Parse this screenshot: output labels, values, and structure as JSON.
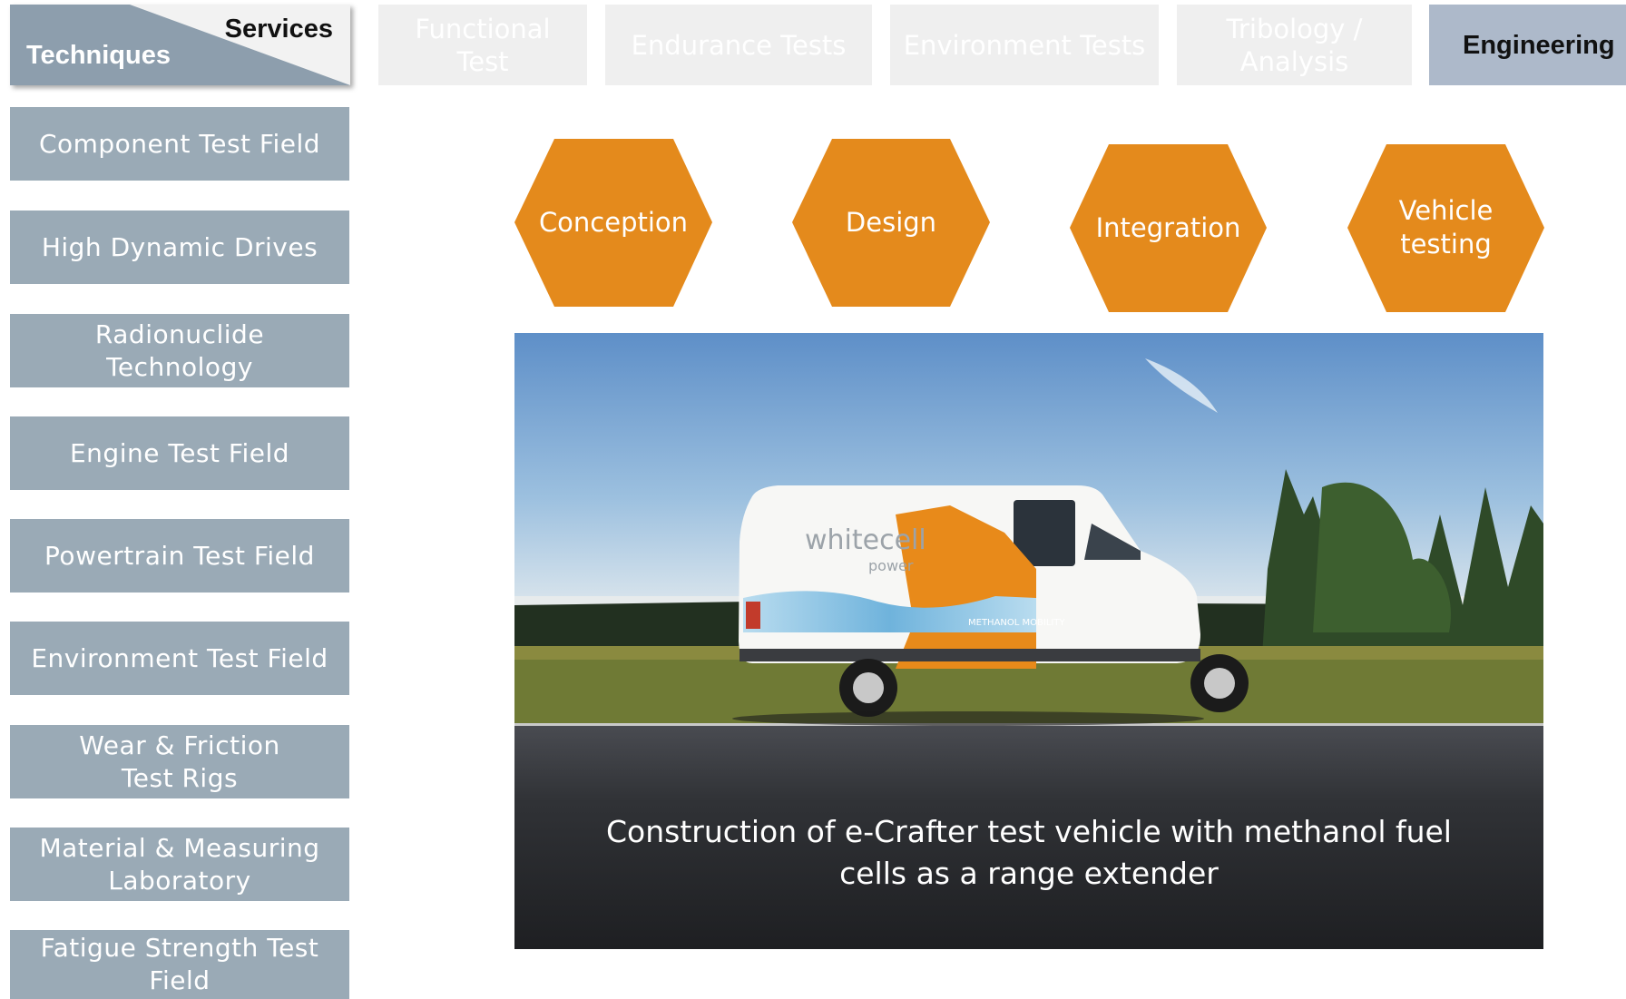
{
  "header": {
    "services_label": "Services",
    "techniques_label": "Techniques"
  },
  "service_tabs": [
    {
      "label": "Functional\nTest",
      "active": false
    },
    {
      "label": "Endurance Tests",
      "active": false
    },
    {
      "label": "Environment Tests",
      "active": false
    },
    {
      "label": "Tribology /\nAnalysis",
      "active": false
    },
    {
      "label": "Engineering",
      "active": true
    }
  ],
  "sidebar": {
    "items": [
      {
        "label": "Component Test Field"
      },
      {
        "label": "High Dynamic Drives"
      },
      {
        "label": "Radionuclide\nTechnology"
      },
      {
        "label": "Engine Test Field"
      },
      {
        "label": "Powertrain Test Field"
      },
      {
        "label": "Environment Test Field"
      },
      {
        "label": "Wear & Friction\nTest Rigs"
      },
      {
        "label": "Material & Measuring\nLaboratory"
      },
      {
        "label": "Fatigue Strength Test\nField"
      }
    ]
  },
  "process_steps": [
    {
      "label": "Conception"
    },
    {
      "label": "Design"
    },
    {
      "label": "Integration"
    },
    {
      "label": "Vehicle\ntesting"
    }
  ],
  "photo": {
    "caption": "Construction of e-Crafter test vehicle with methanol fuel cells as a range extender",
    "van_brand": "whitecell",
    "van_brand_sub": "power",
    "van_slogan": "METHANOL MOBILITY"
  },
  "colors": {
    "accent_orange": "#e48a1c",
    "sidebar_bg": "#9aaab6",
    "active_tab_bg": "#adb9ca",
    "inactive_tab_bg": "#efefef"
  }
}
